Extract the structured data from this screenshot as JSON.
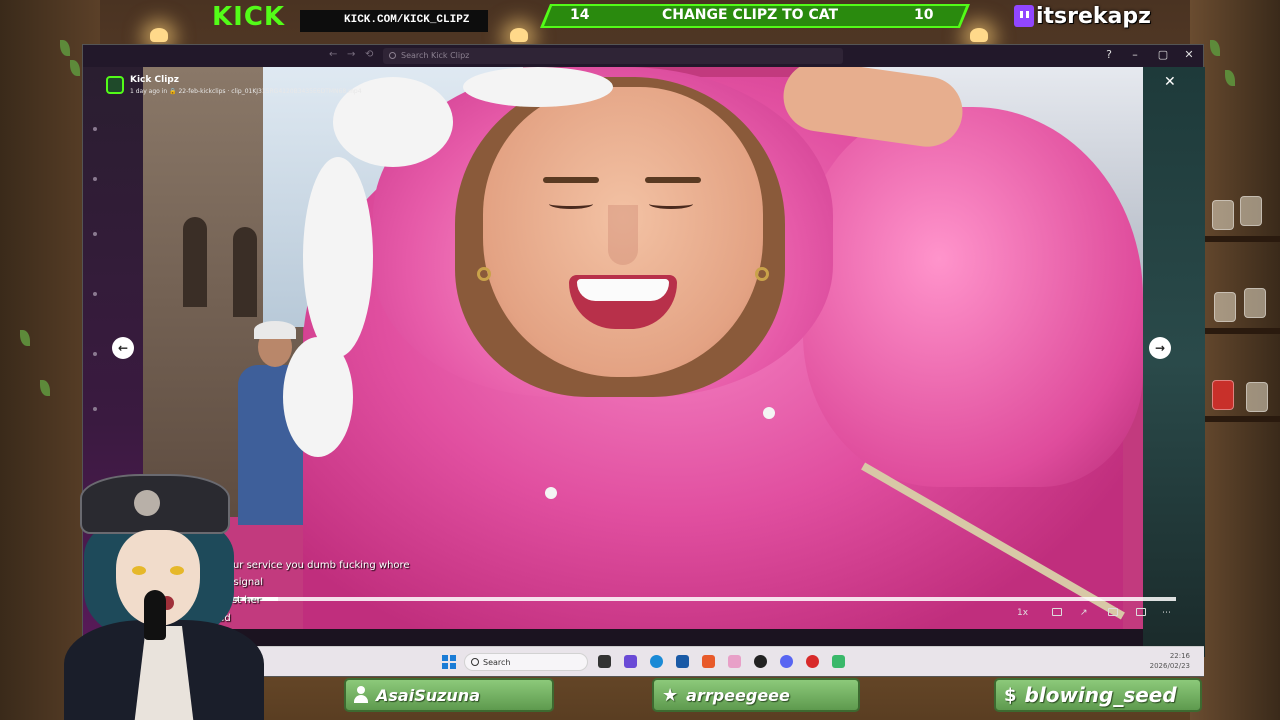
{
  "overlay": {
    "kick_logo": "KICK",
    "kick_url": "KICK.COM/KICK_CLIPZ",
    "vote": {
      "left_count": "14",
      "title": "CHANGE CLIPZ TO CAT",
      "right_count": "10"
    },
    "streamer_handle": "itsrekapz"
  },
  "window": {
    "search_placeholder": "Search Kick Clipz",
    "controls": {
      "help": "?",
      "minimize": "–",
      "maximize": "▢",
      "close": "✕"
    }
  },
  "viewer": {
    "title": "Kick Clipz",
    "meta": "1 day ago in 🔒 22-feb-kickclips  ·  clip_01KJ315RG4120B3435E6DTMN68.mp4",
    "close": "✕",
    "prev": "←",
    "next": "→",
    "speed": "1x",
    "progress_fraction": 0.08,
    "more": "⋯"
  },
  "chat": {
    "lines": [
      {
        "text": "...fix your service you dumb fucking whore"
      },
      {
        "text": "...0% F signal"
      },
      {
        "text": "...we lost her"
      },
      {
        "text": "...addd"
      }
    ]
  },
  "taskbar": {
    "search_label": "Search",
    "time": "22:16",
    "date": "2026/02/23"
  },
  "tags": [
    {
      "icon": "person-icon",
      "label": "AsaiSuzuna"
    },
    {
      "icon": "star-icon",
      "label": "arrpeegeee"
    },
    {
      "icon": "dollar-icon",
      "label": "blowing_seed"
    }
  ]
}
